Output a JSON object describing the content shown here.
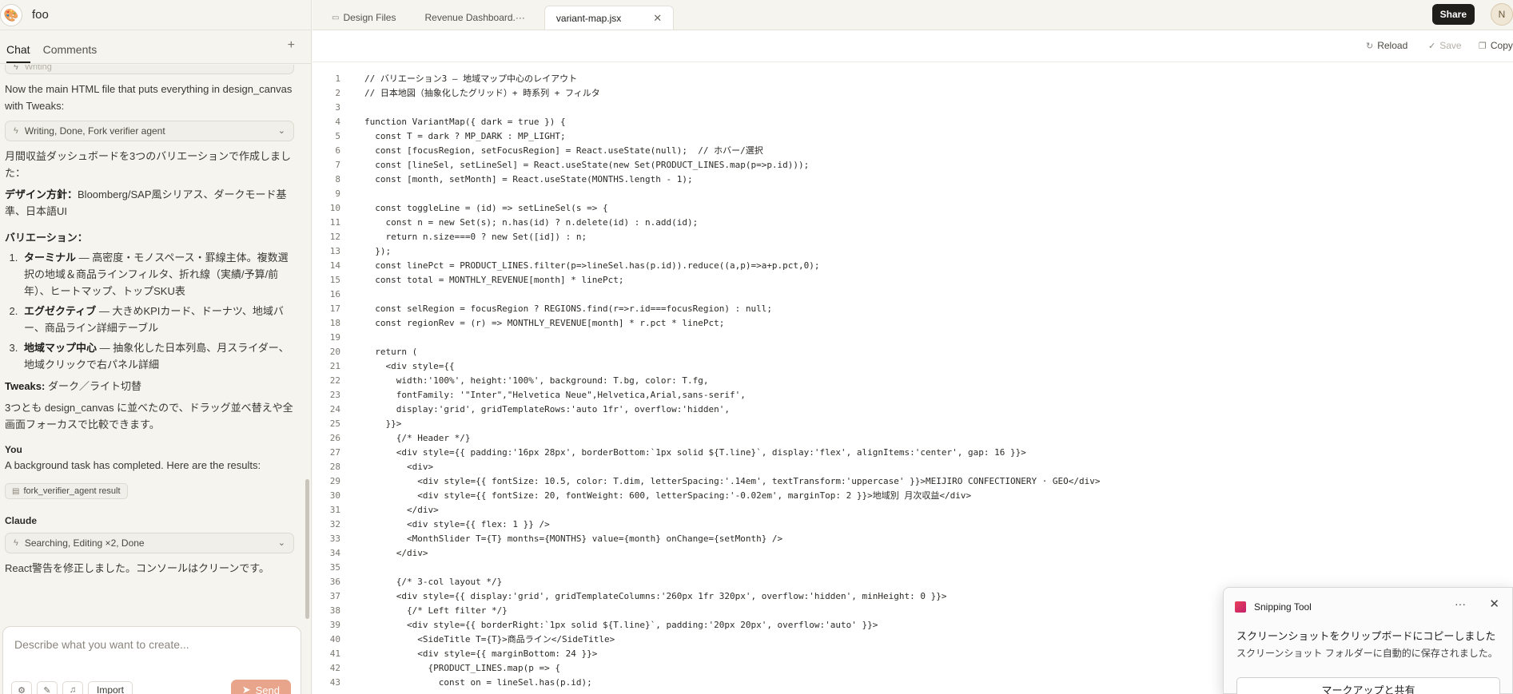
{
  "app": {
    "project_name": "foo"
  },
  "left_panel": {
    "tabs": [
      {
        "label": "Chat",
        "active": true
      },
      {
        "label": "Comments",
        "active": false
      }
    ],
    "add_icon": "plus-icon"
  },
  "chat": {
    "faded_pill": "Writing",
    "msg_intro": "Now the main HTML file that puts everything in design_canvas with Tweaks:",
    "pill_writing": "Writing, Done, Fork verifier agent",
    "summary": "月間収益ダッシュボードを3つのバリエーションで作成しました：",
    "design_label": "デザイン方針：",
    "design_text": "Bloomberg/SAP風シリアス、ダークモード基準、日本語UI",
    "variations_heading": "バリエーション：",
    "variations": [
      {
        "title": "ターミナル",
        "desc": " — 高密度・モノスペース・罫線主体。複数選択の地域＆商品ラインフィルタ、折れ線（実績/予算/前年）、ヒートマップ、トップSKU表"
      },
      {
        "title": "エグゼクティブ",
        "desc": " — 大きめKPIカード、ドーナツ、地域バー、商品ライン詳細テーブル"
      },
      {
        "title": "地域マップ中心",
        "desc": " — 抽象化した日本列島、月スライダー、地域クリックで右パネル詳細"
      }
    ],
    "tweaks_label": "Tweaks:",
    "tweaks_text": " ダーク／ライト切替",
    "canvas_note": "3つとも design_canvas に並べたので、ドラッグ並べ替えや全画面フォーカスで比較できます。",
    "you_label": "You",
    "you_msg": "A background task has completed. Here are the results:",
    "result_chip": "fork_verifier_agent result",
    "claude_label": "Claude",
    "pill_searching": "Searching, Editing ×2, Done",
    "final_msg": "React警告を修正しました。コンソールはクリーンです。"
  },
  "composer": {
    "placeholder": "Describe what you want to create...",
    "import_label": "Import",
    "send_label": "Send"
  },
  "editor": {
    "tabs": [
      {
        "label": "Design Files",
        "icon": "folder-icon",
        "active": false
      },
      {
        "label": "Revenue Dashboard.···",
        "icon": "",
        "active": false
      },
      {
        "label": "variant-map.jsx",
        "icon": "",
        "active": true
      }
    ],
    "share_label": "Share",
    "avatar_initial": "N",
    "toolbar": {
      "reload": "Reload",
      "save": "Save",
      "copy": "Copy"
    },
    "code_lines": [
      "// バリエーション3 — 地域マップ中心のレイアウト",
      "// 日本地図（抽象化したグリッド）+ 時系列 + フィルタ",
      "",
      "function VariantMap({ dark = true }) {",
      "  const T = dark ? MP_DARK : MP_LIGHT;",
      "  const [focusRegion, setFocusRegion] = React.useState(null);  // ホバー/選択",
      "  const [lineSel, setLineSel] = React.useState(new Set(PRODUCT_LINES.map(p=>p.id)));",
      "  const [month, setMonth] = React.useState(MONTHS.length - 1);",
      "",
      "  const toggleLine = (id) => setLineSel(s => {",
      "    const n = new Set(s); n.has(id) ? n.delete(id) : n.add(id);",
      "    return n.size===0 ? new Set([id]) : n;",
      "  });",
      "  const linePct = PRODUCT_LINES.filter(p=>lineSel.has(p.id)).reduce((a,p)=>a+p.pct,0);",
      "  const total = MONTHLY_REVENUE[month] * linePct;",
      "",
      "  const selRegion = focusRegion ? REGIONS.find(r=>r.id===focusRegion) : null;",
      "  const regionRev = (r) => MONTHLY_REVENUE[month] * r.pct * linePct;",
      "",
      "  return (",
      "    <div style={{",
      "      width:'100%', height:'100%', background: T.bg, color: T.fg,",
      "      fontFamily: '\"Inter\",\"Helvetica Neue\",Helvetica,Arial,sans-serif',",
      "      display:'grid', gridTemplateRows:'auto 1fr', overflow:'hidden',",
      "    }}>",
      "      {/* Header */}",
      "      <div style={{ padding:'16px 28px', borderBottom:`1px solid ${T.line}`, display:'flex', alignItems:'center', gap: 16 }}>",
      "        <div>",
      "          <div style={{ fontSize: 10.5, color: T.dim, letterSpacing:'.14em', textTransform:'uppercase' }}>MEIJIRO CONFECTIONERY · GEO</div>",
      "          <div style={{ fontSize: 20, fontWeight: 600, letterSpacing:'-0.02em', marginTop: 2 }}>地域別 月次収益</div>",
      "        </div>",
      "        <div style={{ flex: 1 }} />",
      "        <MonthSlider T={T} months={MONTHS} value={month} onChange={setMonth} />",
      "      </div>",
      "",
      "      {/* 3-col layout */}",
      "      <div style={{ display:'grid', gridTemplateColumns:'260px 1fr 320px', overflow:'hidden', minHeight: 0 }}>",
      "        {/* Left filter */}",
      "        <div style={{ borderRight:`1px solid ${T.line}`, padding:'20px 20px', overflow:'auto' }}>",
      "          <SideTitle T={T}>商品ライン</SideTitle>",
      "          <div style={{ marginBottom: 24 }}>",
      "            {PRODUCT_LINES.map(p => {",
      "              const on = lineSel.has(p.id);"
    ]
  },
  "toast": {
    "app_name": "Snipping Tool",
    "title": "スクリーンショットをクリップボードにコピーしました",
    "subtitle": "スクリーンショット フォルダーに自動的に保存されました。",
    "button": "マークアップと共有"
  }
}
